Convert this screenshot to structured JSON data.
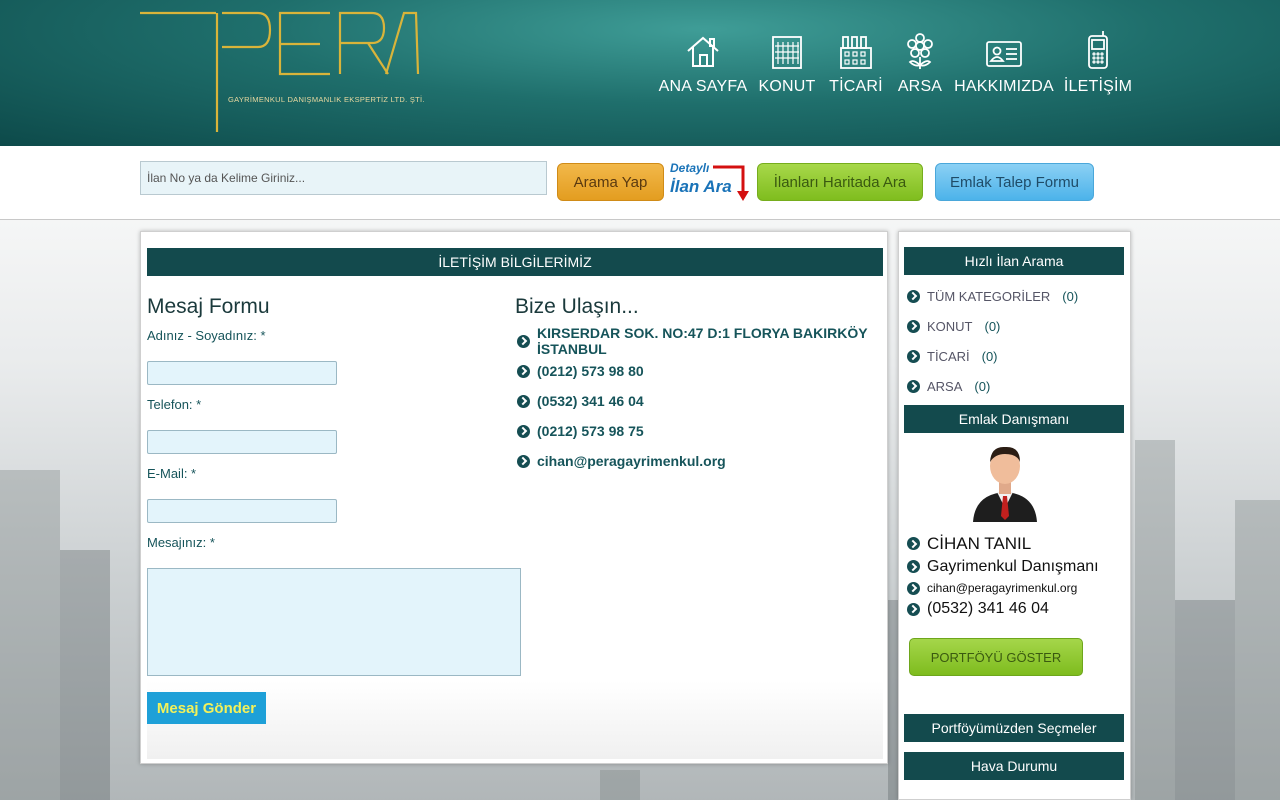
{
  "header": {
    "logo_text": "PERA",
    "logo_subtitle": "GAYRİMENKUL DANIŞMANLIK EKSPERTİZ LTD. ŞTİ.",
    "nav": [
      {
        "label": "ANA SAYFA",
        "icon": "home-icon"
      },
      {
        "label": "KONUT",
        "icon": "building-icon"
      },
      {
        "label": "TİCARİ",
        "icon": "factory-icon"
      },
      {
        "label": "ARSA",
        "icon": "flower-icon"
      },
      {
        "label": "HAKKIMIZDA",
        "icon": "id-card-icon"
      },
      {
        "label": "İLETİŞİM",
        "icon": "mobile-phone-icon"
      }
    ]
  },
  "search": {
    "placeholder": "İlan No ya da Kelime Giriniz...",
    "search_button": "Arama Yap",
    "detail_line1": "Detaylı",
    "detail_line2": "İlan Ara",
    "map_button": "İlanları Haritada Ara",
    "form_button": "Emlak Talep Formu"
  },
  "main": {
    "section_title": "İLETİŞİM BİLGİLERİMİZ",
    "form": {
      "title": "Mesaj Formu",
      "name_label": "Adınız - Soyadınız: *",
      "phone_label": "Telefon: *",
      "email_label": "E-Mail: *",
      "message_label": "Mesajınız: *",
      "send_button": "Mesaj Gönder"
    },
    "contact": {
      "title": "Bize Ulaşın...",
      "items": [
        "KIRSERDAR SOK. NO:47 D:1 FLORYA BAKIRKÖY İSTANBUL",
        "(0212) 573 98 80",
        "(0532) 341 46 04",
        "(0212) 573 98 75",
        "cihan@peragayrimenkul.org"
      ]
    }
  },
  "sidebar": {
    "quick_search_title": "Hızlı İlan Arama",
    "categories": [
      {
        "label": "TÜM KATEGORİLER",
        "count": "(0)"
      },
      {
        "label": "KONUT",
        "count": "(0)"
      },
      {
        "label": "TİCARİ",
        "count": "(0)"
      },
      {
        "label": "ARSA",
        "count": "(0)"
      }
    ],
    "agent_title": "Emlak Danışmanı",
    "agent": {
      "name": "CİHAN TANIL",
      "role": "Gayrimenkul Danışmanı",
      "email": "cihan@peragayrimenkul.org",
      "phone": "(0532) 341 46 04"
    },
    "portfolio_button": "PORTFÖYÜ GÖSTER",
    "selections_title": "Portföyümüzden Seçmeler",
    "weather_title": "Hava Durumu"
  },
  "colors": {
    "header_teal": "#1f6f6c",
    "bar_dark": "#134a4d",
    "logo_gold": "#d9b43a"
  }
}
